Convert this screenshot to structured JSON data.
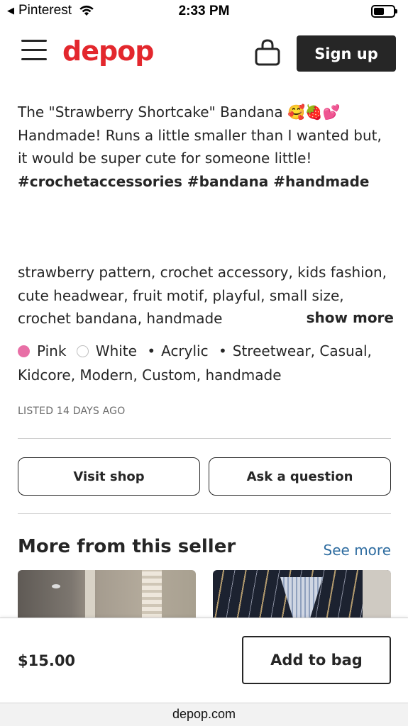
{
  "status_bar": {
    "back_app": "Pinterest",
    "time": "2:33 PM",
    "battery_level": 0.55
  },
  "header": {
    "logo": "depop",
    "signup_label": "Sign up"
  },
  "listing": {
    "description_text": "The \"Strawberry Shortcake\" Bandana 🥰🍓💕 Handmade! Runs a little smaller than I wanted but, it would be super cute for someone little!",
    "hashtags": "#crochetaccessories #bandana #handmade",
    "tags_text": "strawberry pattern, crochet accessory, kids fashion, cute headwear, fruit motif, playful, small size, crochet bandana, handmade",
    "show_more_label": "show more",
    "colors": [
      {
        "name": "Pink",
        "swatch": "#e86fa6"
      },
      {
        "name": "White",
        "swatch": "#ffffff"
      }
    ],
    "material": "Acrylic",
    "styles": "Streetwear, Casual, Kidcore, Modern, Custom, handmade",
    "listed": "LISTED 14 DAYS AGO"
  },
  "actions": {
    "visit_shop": "Visit shop",
    "ask_question": "Ask a question"
  },
  "more_from_seller": {
    "title": "More from this seller",
    "see_more": "See more"
  },
  "footer": {
    "price": "$15.00",
    "add_to_bag": "Add to bag"
  },
  "browser": {
    "url": "depop.com"
  }
}
